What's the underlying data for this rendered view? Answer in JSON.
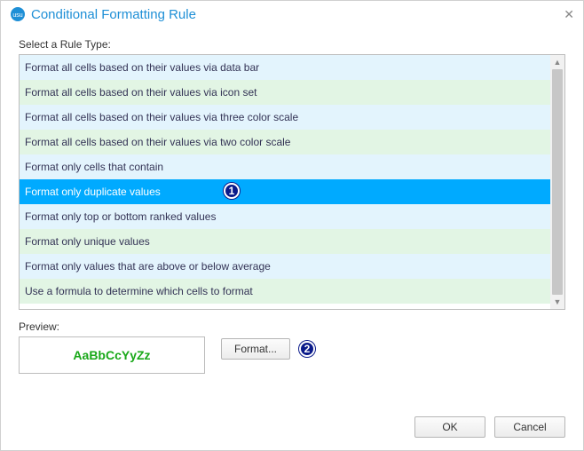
{
  "dialog": {
    "title": "Conditional Formatting Rule",
    "close_glyph": "✕",
    "logo_text": "usu"
  },
  "labels": {
    "select_rule_type": "Select a Rule Type:",
    "preview": "Preview:"
  },
  "rule_list": {
    "items": [
      "Format all cells based on their values via data bar",
      "Format all cells based on their values via icon set",
      "Format all cells based on their values via three color scale",
      "Format all cells based on their values via two color scale",
      "Format only cells that contain",
      "Format only duplicate values",
      "Format only top or bottom ranked values",
      "Format only unique values",
      "Format only values that are above or below average",
      "Use a formula to determine which cells to format"
    ],
    "selected_index": 5
  },
  "preview": {
    "sample_text": "AaBbCcYyZz",
    "text_color": "#18a818"
  },
  "buttons": {
    "format": "Format...",
    "ok": "OK",
    "cancel": "Cancel"
  },
  "callouts": {
    "step1": "1",
    "step2": "2"
  },
  "scrollbar": {
    "up_glyph": "▲",
    "down_glyph": "▼"
  }
}
